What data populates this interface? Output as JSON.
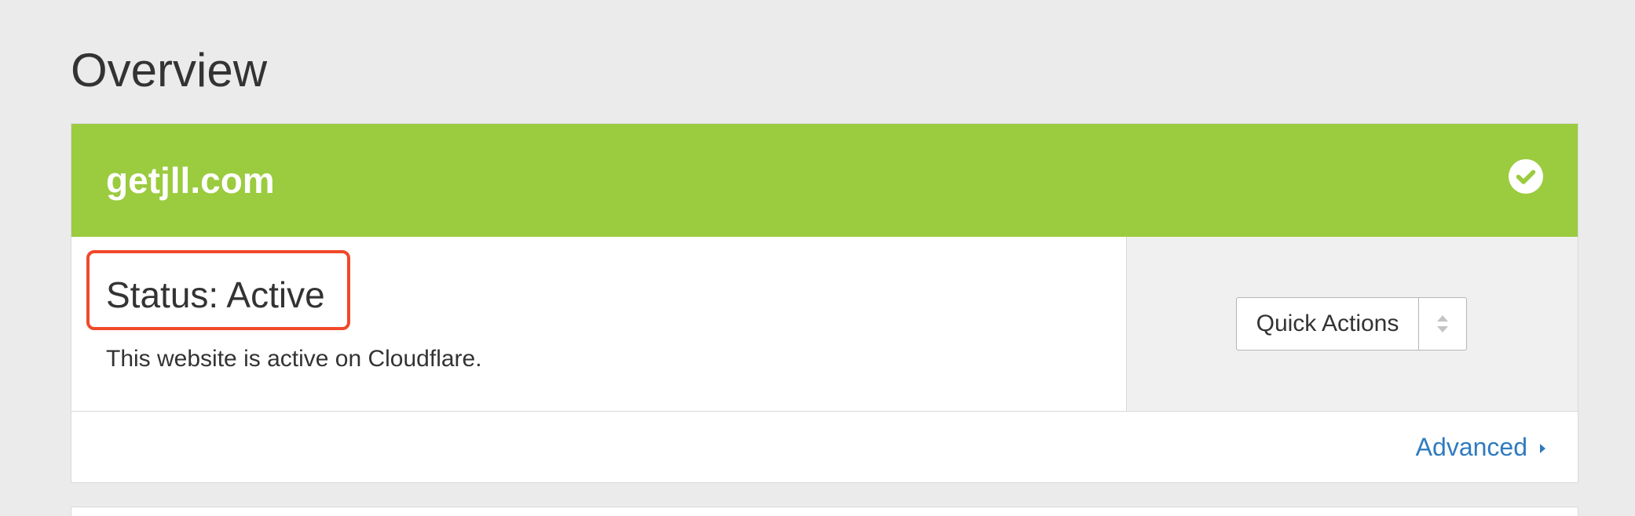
{
  "page": {
    "title": "Overview"
  },
  "site": {
    "domain": "getjll.com",
    "status_icon": "check-circle-icon",
    "header_color": "#9bcb3f"
  },
  "status": {
    "title": "Status: Active",
    "description": "This website is active on Cloudflare.",
    "highlight_color": "#f0492a"
  },
  "actions": {
    "quick_actions_label": "Quick Actions",
    "quick_actions_icon": "sort-arrows-icon"
  },
  "footer": {
    "advanced_label": "Advanced",
    "advanced_icon": "caret-right-icon",
    "link_color": "#2f7bbf"
  }
}
